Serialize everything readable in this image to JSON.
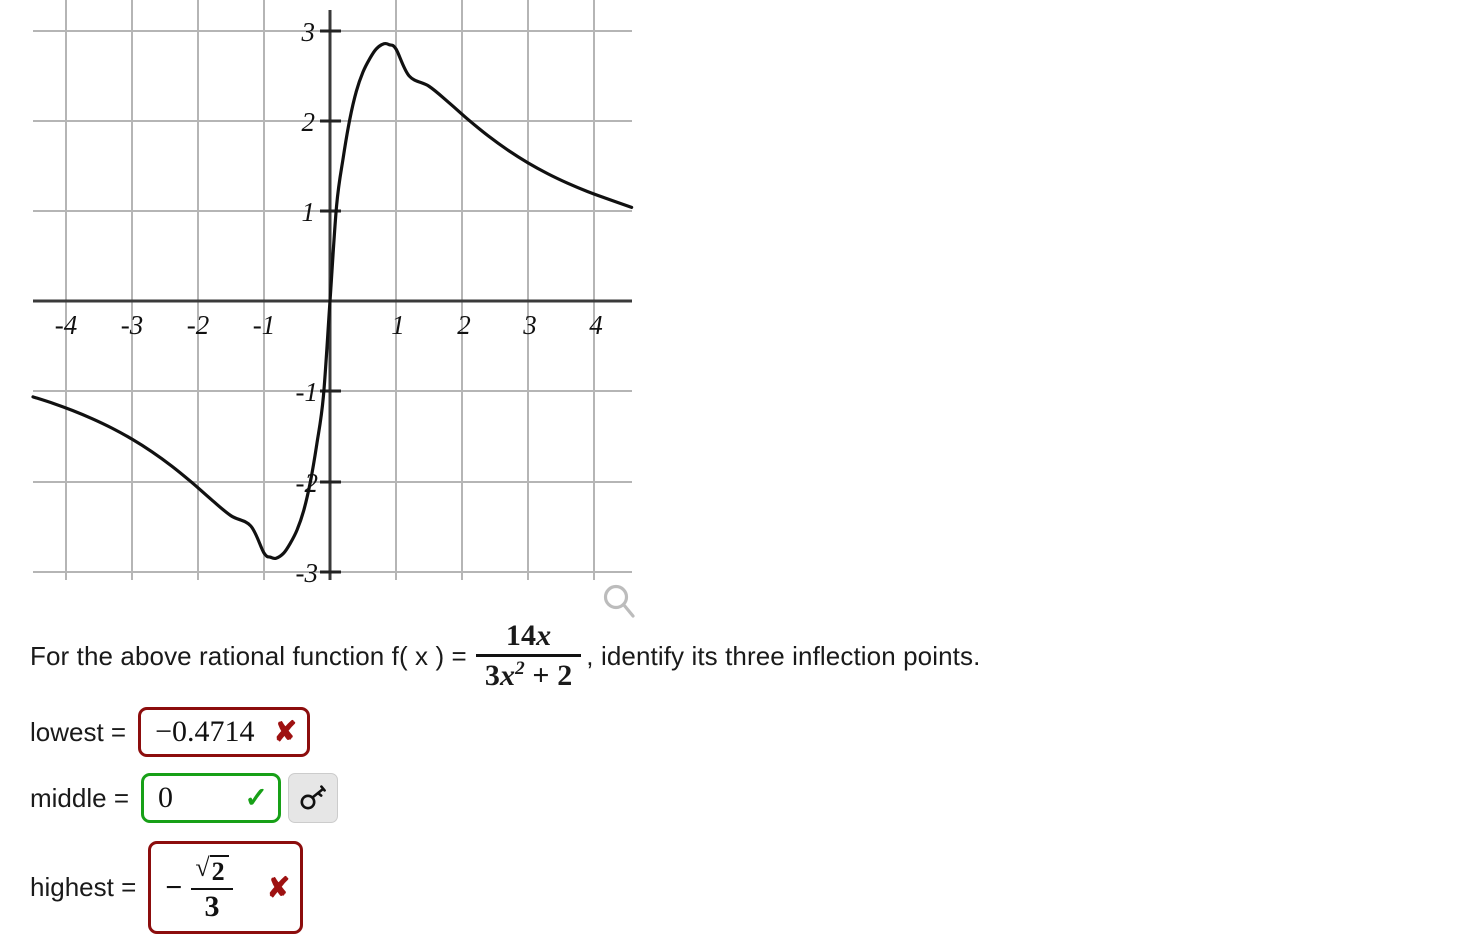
{
  "chart_data": {
    "type": "line",
    "title": "",
    "xlabel": "",
    "ylabel": "",
    "function_latex": "14x/(3x^2+2)",
    "xlim": [
      -4.5,
      4.57
    ],
    "ylim": [
      -3.1,
      3.1
    ],
    "grid": true,
    "legend": null,
    "x_ticks": [
      -4,
      -3,
      -2,
      -1,
      1,
      2,
      3,
      4
    ],
    "y_ticks": [
      -3,
      -2,
      -1,
      1,
      2,
      3
    ],
    "x_tick_labels": [
      "-4",
      "-3",
      "-2",
      "-1",
      "1",
      "2",
      "3",
      "4"
    ],
    "y_tick_labels": [
      "-3",
      "-2",
      "-1",
      "1",
      "2",
      "3"
    ],
    "series": [
      {
        "name": "f(x) = 14x / (3x^2 + 2)",
        "x": [
          -4.5,
          -4.2,
          -3.9,
          -3.6,
          -3.3,
          -3.0,
          -2.7,
          -2.4,
          -2.1,
          -1.8,
          -1.5,
          -1.2,
          -1.0,
          -0.9,
          -0.8166,
          -0.7,
          -0.6,
          -0.5,
          -0.4,
          -0.3,
          -0.2,
          -0.1,
          0,
          0.1,
          0.2,
          0.3,
          0.4,
          0.5,
          0.6,
          0.7,
          0.8166,
          0.9,
          1.0,
          1.2,
          1.5,
          1.8,
          2.1,
          2.4,
          2.7,
          3.0,
          3.3,
          3.6,
          3.9,
          4.2,
          4.57
        ],
        "y": [
          -1.065,
          -1.136,
          -1.217,
          -1.309,
          -1.414,
          -1.535,
          -1.674,
          -1.833,
          -2.012,
          -2.205,
          -2.386,
          -2.5,
          -2.8,
          -2.847,
          -2.858,
          -2.8,
          -2.69,
          -2.545,
          -2.333,
          -2.019,
          -1.591,
          -1.06,
          0,
          1.06,
          1.591,
          2.019,
          2.333,
          2.545,
          2.69,
          2.8,
          2.858,
          2.847,
          2.8,
          2.5,
          2.386,
          2.205,
          2.012,
          1.833,
          1.674,
          1.535,
          1.414,
          1.309,
          1.217,
          1.136,
          1.04
        ]
      }
    ]
  },
  "graph": {
    "zoom_icon_name": "magnifier-icon"
  },
  "prompt": {
    "lead": "For the above rational function f( x ) =",
    "fraction_numerator_coefficient": "14",
    "fraction_numerator_variable": "x",
    "fraction_denominator_coefficient": "3",
    "fraction_denominator_variable": "x",
    "fraction_denominator_exponent": "2",
    "fraction_denominator_plus": "+",
    "fraction_denominator_constant": "2",
    "tail": ", identify its three inflection points."
  },
  "answers": [
    {
      "label": "lowest =",
      "value": "−0.4714",
      "status": "wrong",
      "mark": "✘",
      "has_key_button": false
    },
    {
      "label": "middle =",
      "value": "0",
      "status": "right",
      "mark": "✓",
      "has_key_button": true
    },
    {
      "label": "highest =",
      "value_sign": "−",
      "value_radicand": "2",
      "value_denominator": "3",
      "status": "wrong",
      "mark": "✘",
      "has_key_button": false
    }
  ],
  "key_button": {
    "icon": "key-icon",
    "tooltip": ""
  },
  "colors": {
    "wrong_border": "#8c0d0d",
    "wrong_mark": "#9e1111",
    "right_border": "#17a017",
    "right_mark": "#17a017",
    "grid": "#b5b5b5",
    "axis": "#3a3a3a",
    "curve": "#111111",
    "key_button_bg": "#e6e6e6"
  }
}
